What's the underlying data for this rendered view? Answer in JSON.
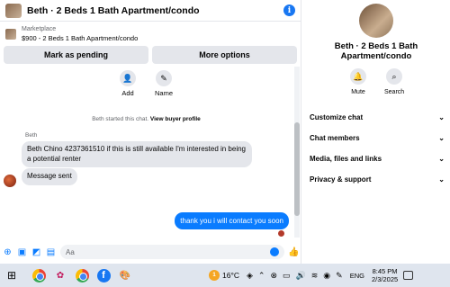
{
  "chat": {
    "title": "Beth · 2 Beds 1 Bath Apartment/condo",
    "marketplace_label": "Marketplace",
    "listing": "$900 - 2 Beds 1 Bath Apartment/condo",
    "mark_pending": "Mark as pending",
    "more_options": "More options",
    "add_label": "Add",
    "name_label": "Name",
    "started_text": "Beth started this chat.",
    "view_profile": "View buyer profile",
    "sender_name": "Beth",
    "message_1": "Beth Chino 4237361510 if this is still available I'm interested in being a potential renter",
    "message_2": "Message sent",
    "message_out": "thank you i will contact you soon",
    "input_placeholder": "Aa"
  },
  "side": {
    "title": "Beth · 2 Beds 1 Bath Apartment/condo",
    "mute": "Mute",
    "search": "Search",
    "menu": [
      {
        "label": "Customize chat"
      },
      {
        "label": "Chat members"
      },
      {
        "label": "Media, files and links"
      },
      {
        "label": "Privacy & support"
      }
    ]
  },
  "taskbar": {
    "temperature": "16°C",
    "weather_badge": "1",
    "language": "ENG",
    "time": "8:45 PM",
    "date": "2/3/2025"
  },
  "colors": {
    "accent": "#0a7cff",
    "bubble_in": "#e4e6eb",
    "taskbar": "#dfe5ee"
  }
}
